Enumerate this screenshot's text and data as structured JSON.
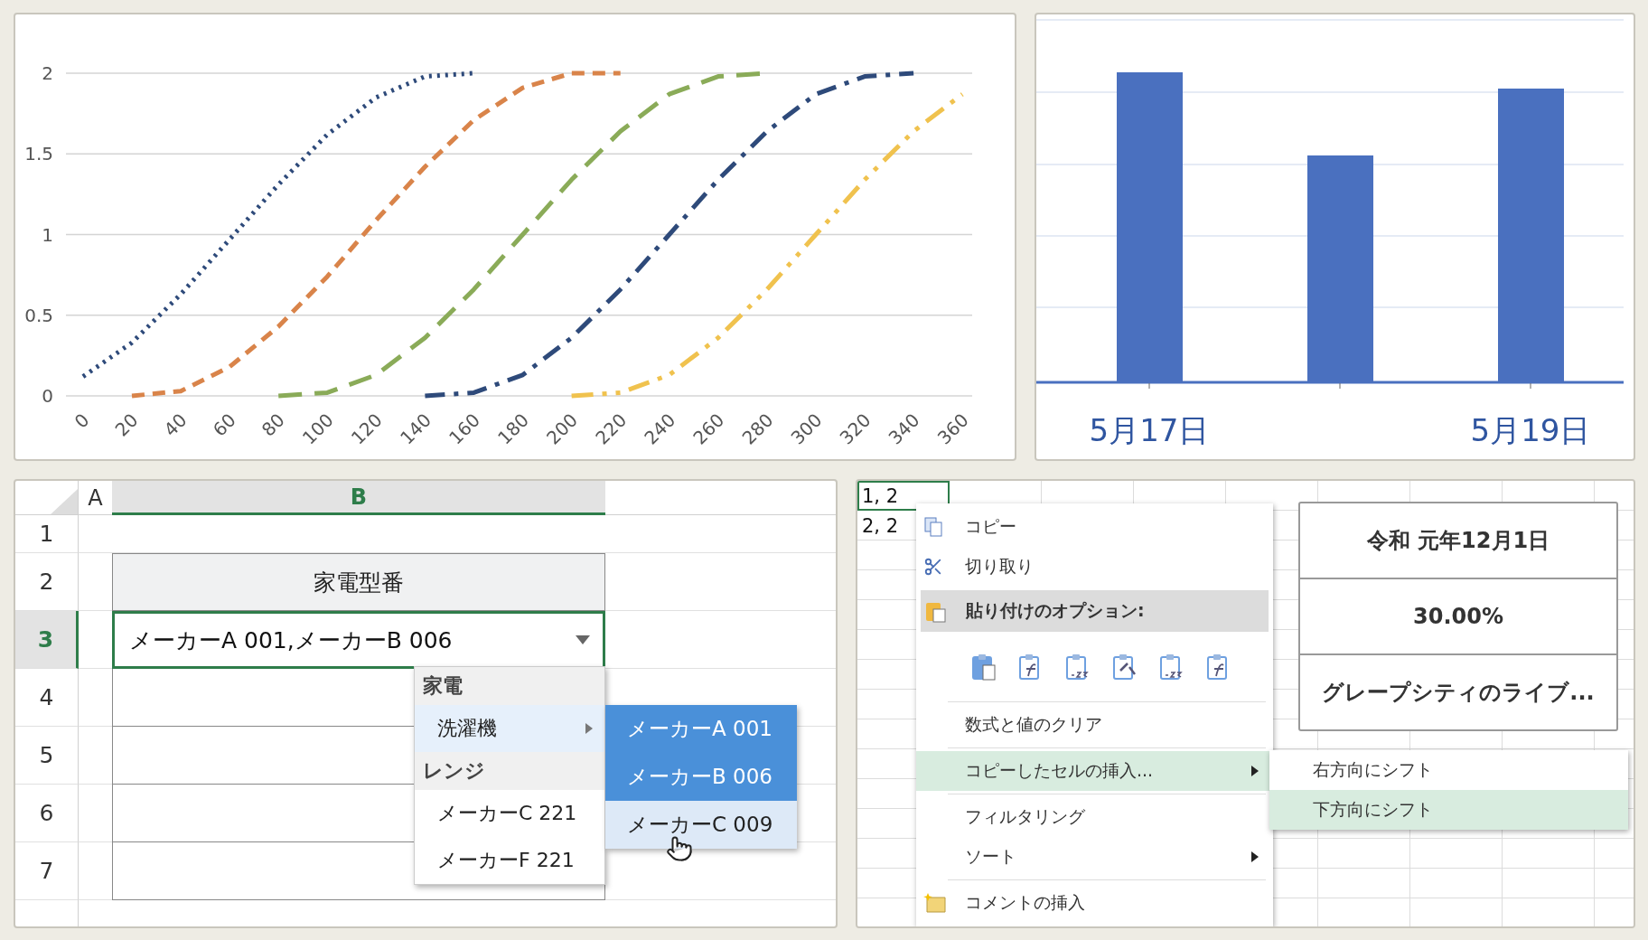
{
  "line_chart": {
    "chart_data": {
      "type": "line",
      "x": [
        0,
        20,
        40,
        60,
        80,
        100,
        120,
        140,
        160,
        180,
        200,
        220,
        240,
        260,
        280,
        300,
        320,
        340,
        360
      ],
      "xlim": [
        -7,
        364
      ],
      "ylim": [
        0,
        2
      ],
      "grid": true,
      "yticks": [
        0,
        0.5,
        1,
        1.5,
        2
      ],
      "xticks": [
        0,
        20,
        40,
        60,
        80,
        100,
        120,
        140,
        160,
        180,
        200,
        220,
        240,
        260,
        280,
        300,
        320,
        340,
        360
      ],
      "series": [
        {
          "color": "#2e4a7a",
          "line_style": "dotted",
          "values": [
            0.12,
            0.33,
            0.63,
            0.97,
            1.31,
            1.62,
            1.85,
            1.98,
            2,
            null,
            null,
            null,
            null,
            null,
            null,
            null,
            null,
            null,
            null
          ]
        },
        {
          "color": "#d9844a",
          "line_style": "dashed",
          "values": [
            null,
            0,
            0.03,
            0.18,
            0.43,
            0.74,
            1.09,
            1.42,
            1.71,
            1.91,
            2,
            2,
            null,
            null,
            null,
            null,
            null,
            null,
            null
          ]
        },
        {
          "color": "#8aab58",
          "line_style": "long_dash",
          "values": [
            null,
            null,
            null,
            null,
            0,
            0.02,
            0.13,
            0.36,
            0.66,
            1,
            1.34,
            1.64,
            1.87,
            1.98,
            2,
            null,
            null,
            null,
            null
          ]
        },
        {
          "color": "#2e4a7a",
          "line_style": "dash_dot",
          "values": [
            null,
            null,
            null,
            null,
            null,
            null,
            null,
            0,
            0.02,
            0.13,
            0.36,
            0.66,
            1,
            1.34,
            1.64,
            1.87,
            1.98,
            2,
            null
          ]
        },
        {
          "color": "#f0c24e",
          "line_style": "dash_dot_dot",
          "values": [
            null,
            null,
            null,
            null,
            null,
            null,
            null,
            null,
            null,
            null,
            0,
            0.02,
            0.13,
            0.36,
            0.66,
            1,
            1.34,
            1.64,
            1.87
          ]
        }
      ]
    }
  },
  "bar_chart": {
    "category_labels": [
      "5月17日",
      "5月19日"
    ]
  },
  "sheet": {
    "columns": [
      {
        "label": "A",
        "selected": false
      },
      {
        "label": "B",
        "selected": true
      }
    ],
    "rows": [
      {
        "label": "1",
        "selected": false
      },
      {
        "label": "2",
        "selected": false
      },
      {
        "label": "3",
        "selected": true
      },
      {
        "label": "4",
        "selected": false
      },
      {
        "label": "5",
        "selected": false
      },
      {
        "label": "6",
        "selected": false
      },
      {
        "label": "7",
        "selected": false
      }
    ],
    "header_cell": "家電型番",
    "value_cell": "メーカーA 001,メーカーB 006",
    "dropdown": [
      {
        "kind": "group",
        "label": "家電"
      },
      {
        "kind": "item",
        "label": "洗濯機",
        "has_submenu": true,
        "selected": true
      },
      {
        "kind": "group",
        "label": "レンジ"
      },
      {
        "kind": "item",
        "label": "メーカーC 221",
        "has_submenu": false,
        "selected": false
      },
      {
        "kind": "item",
        "label": "メーカーF 221",
        "has_submenu": false,
        "selected": false
      }
    ],
    "submenu": [
      {
        "label": "メーカーA 001",
        "selected": true,
        "hovered": false
      },
      {
        "label": "メーカーB 006",
        "selected": true,
        "hovered": false
      },
      {
        "label": "メーカーC 009",
        "selected": false,
        "hovered": true
      }
    ]
  },
  "context_sheet": {
    "cells": [
      {
        "text": "1, 2",
        "selected": true
      },
      {
        "text": "2, 2",
        "selected": false
      }
    ],
    "menu": [
      {
        "kind": "copy",
        "label": "コピー",
        "selected": false,
        "has_submenu": false
      },
      {
        "kind": "cut",
        "label": "切り取り",
        "selected": false,
        "has_submenu": false
      },
      {
        "kind": "paste_header",
        "label": "貼り付けのオプション:"
      },
      {
        "kind": "paste_options"
      },
      {
        "kind": "separator"
      },
      {
        "kind": "item",
        "label": "数式と値のクリア",
        "selected": false,
        "has_submenu": false
      },
      {
        "kind": "separator"
      },
      {
        "kind": "item",
        "label": "コピーしたセルの挿入...",
        "selected": true,
        "has_submenu": true
      },
      {
        "kind": "separator"
      },
      {
        "kind": "item",
        "label": "フィルタリング",
        "selected": false,
        "has_submenu": false
      },
      {
        "kind": "item",
        "label": "ソート",
        "selected": false,
        "has_submenu": true
      },
      {
        "kind": "separator"
      },
      {
        "kind": "comment",
        "label": "コメントの挿入",
        "selected": false,
        "has_submenu": false
      }
    ],
    "submenu": [
      {
        "label": "右方向にシフト",
        "selected": false
      },
      {
        "label": "下方向にシフト",
        "selected": true
      }
    ],
    "cards": [
      "令和 元年12月1日",
      "30.00%",
      "グレープシティのライブ..."
    ]
  }
}
